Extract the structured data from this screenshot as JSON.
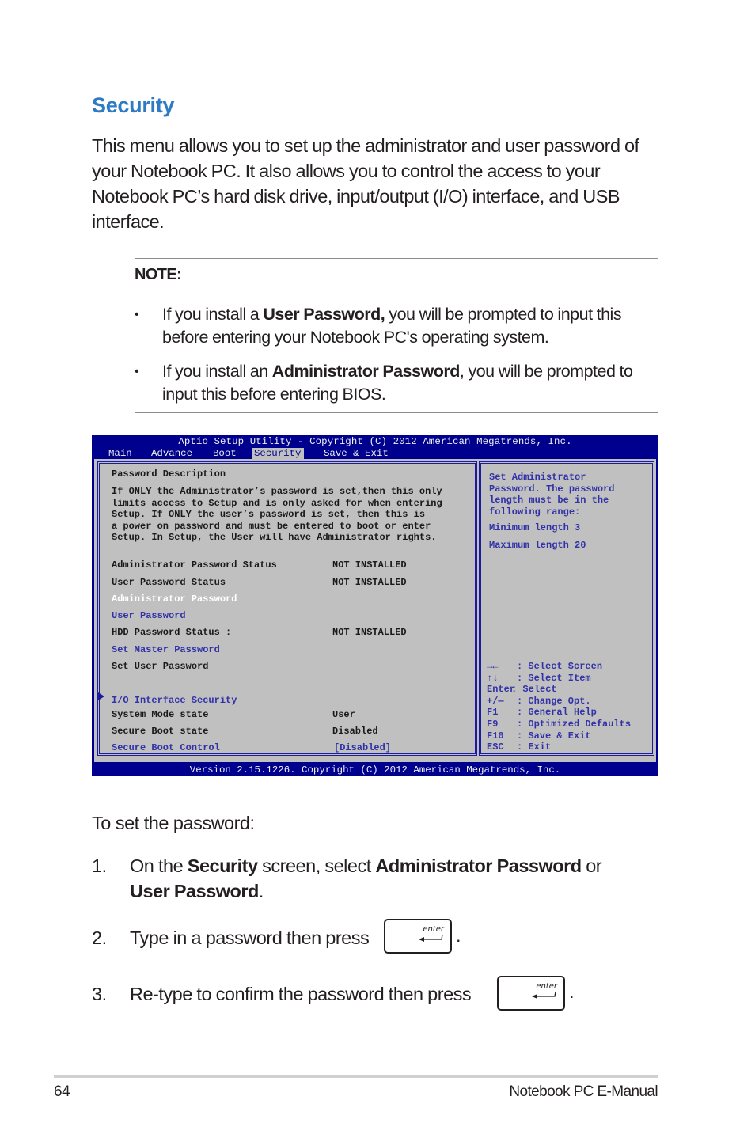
{
  "heading": "Security",
  "intro": "This menu allows you to set up the administrator and user password of your Notebook PC. It also allows you to control the access to your Notebook PC’s hard disk drive, input/output (I/O) interface, and USB interface.",
  "note": {
    "title": "NOTE:",
    "items": [
      {
        "pre": "If you install a ",
        "bold": "User Password,",
        "post": " you will be prompted to input this before entering your Notebook PC's operating system."
      },
      {
        "pre": "If you install an ",
        "bold": "Administrator Password",
        "post": ", you will be prompted to input this before entering BIOS."
      }
    ]
  },
  "bios": {
    "title": "Aptio Setup Utility - Copyright (C) 2012 American Megatrends, Inc.",
    "tabs": [
      "Main",
      "Advance",
      "Boot",
      "Security",
      "Save & Exit"
    ],
    "active_tab": "Security",
    "description_title": "Password Description",
    "description": [
      "If ONLY the Administrator’s password is set,then this only",
      "limits access to Setup and is only asked for when entering",
      "Setup. If ONLY the user’s password is set, then this is",
      "a power on password and must be entered to boot or enter",
      "Setup. In Setup, the User will have Administrator rights."
    ],
    "items": [
      {
        "label": "Administrator Password Status",
        "value": "NOT INSTALLED"
      },
      {
        "label": "User Password Status",
        "value": "NOT INSTALLED"
      },
      {
        "label": "Administrator Password",
        "value": ""
      },
      {
        "label": "User Password",
        "value": ""
      },
      {
        "label": "HDD Password Status :",
        "value": "NOT INSTALLED"
      },
      {
        "label": "Set Master Password",
        "value": ""
      },
      {
        "label": "Set User Password",
        "value": ""
      },
      {
        "label": "I/O Interface Security",
        "value": ""
      },
      {
        "label": "System Mode state",
        "value": "User"
      },
      {
        "label": "Secure Boot state",
        "value": "Disabled"
      },
      {
        "label": "Secure Boot Control",
        "value": "[Disabled]"
      }
    ],
    "help": [
      "Set Administrator",
      "Password. The password",
      "length must be in the",
      "following range:",
      "Minimum length 3",
      "Maximum length 20"
    ],
    "keys": [
      {
        "key": "→←",
        "desc": ": Select Screen"
      },
      {
        "key": "↑↓",
        "desc": ": Select Item"
      },
      {
        "key": "Enter",
        "desc": ": Select"
      },
      {
        "key": "+/—",
        "desc": ": Change Opt."
      },
      {
        "key": "F1",
        "desc": ": General Help"
      },
      {
        "key": "F9",
        "desc": ": Optimized Defaults"
      },
      {
        "key": "F10",
        "desc": ": Save & Exit"
      },
      {
        "key": "ESC",
        "desc": ": Exit"
      }
    ],
    "footer": "Version 2.15.1226. Copyright (C) 2012 American Megatrends, Inc.",
    "colors": {
      "background": "#00008f",
      "panel": "#c0c0c0",
      "link": "#3232a8",
      "selected": "#ffffff"
    }
  },
  "steps": {
    "intro": "To set the password:",
    "list": [
      {
        "num": "1.",
        "parts": [
          "On the ",
          "Security",
          " screen, select ",
          "Administrator Password",
          " or",
          "User Password",
          "."
        ]
      },
      {
        "num": "2.",
        "text": "Type in a password then press"
      },
      {
        "num": "3.",
        "text": "Re-type to confirm the password then press"
      }
    ],
    "key_label": "enter"
  },
  "footer": {
    "page": "64",
    "manual": "Notebook PC E-Manual"
  },
  "colors": {
    "heading": "#2e7bc4",
    "text": "#231f20"
  }
}
